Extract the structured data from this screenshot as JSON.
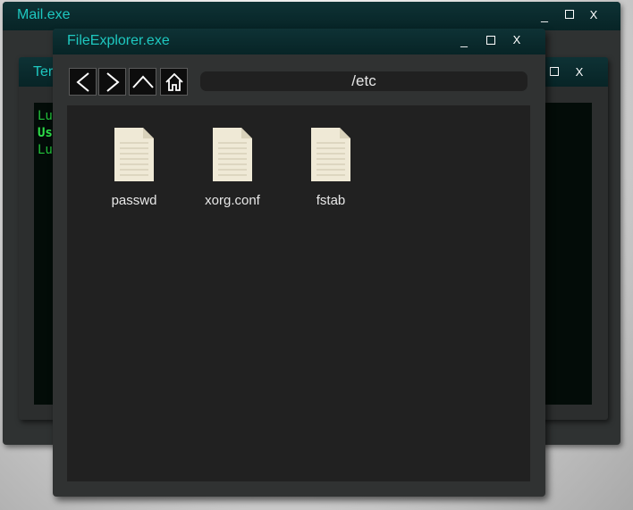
{
  "mail_window": {
    "title": "Mail.exe",
    "controls": {
      "minimize": "_",
      "close": "X"
    }
  },
  "terminal_window": {
    "title": "Ter",
    "controls": {
      "close": "X"
    },
    "lines": [
      "Lu",
      "Us",
      "Lu"
    ]
  },
  "explorer_window": {
    "title": "FileExplorer.exe",
    "controls": {
      "minimize": "_",
      "close": "X"
    },
    "toolbar": {
      "back_icon": "chevron-left-icon",
      "forward_icon": "chevron-right-icon",
      "up_icon": "chevron-up-icon",
      "home_icon": "home-icon"
    },
    "path": "/etc",
    "files": [
      {
        "name": "passwd",
        "icon": "document-icon"
      },
      {
        "name": "xorg.conf",
        "icon": "document-icon"
      },
      {
        "name": "fstab",
        "icon": "document-icon"
      }
    ]
  },
  "colors": {
    "title_text": "#1ec8c0",
    "titlebar": "#0a2a2c",
    "terminal_text": "#22c23a",
    "file_icon": "#efe9d6"
  }
}
